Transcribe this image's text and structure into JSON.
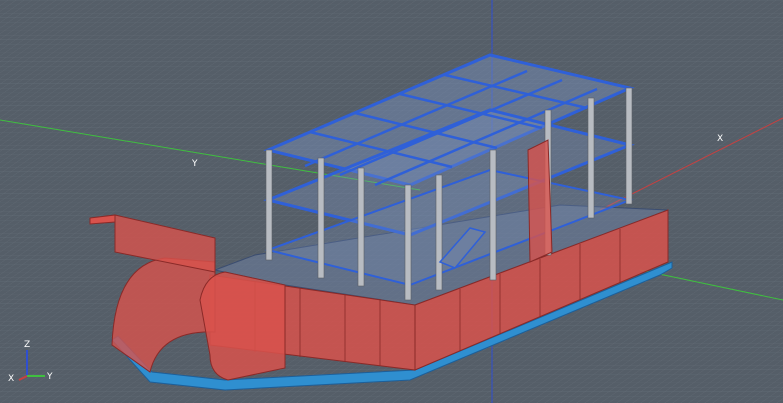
{
  "viewport": {
    "background": "#555e68",
    "grid_color": "#6f7882",
    "axis_labels": {
      "x": "X",
      "y": "Y"
    },
    "axis_colors": {
      "x": "#c84040",
      "y": "#3fbf3f",
      "z": "#2f4fd0"
    }
  },
  "model": {
    "wall_color": "#d8524c",
    "wall_edge": "#8a2a28",
    "frame_color": "#2f60d8",
    "column_color": "#b8bcc2",
    "slab_color": "#7a93bf",
    "footing_color": "#2f8fd0"
  },
  "triad": {
    "z": "Z",
    "x": "X",
    "y": "Y"
  }
}
